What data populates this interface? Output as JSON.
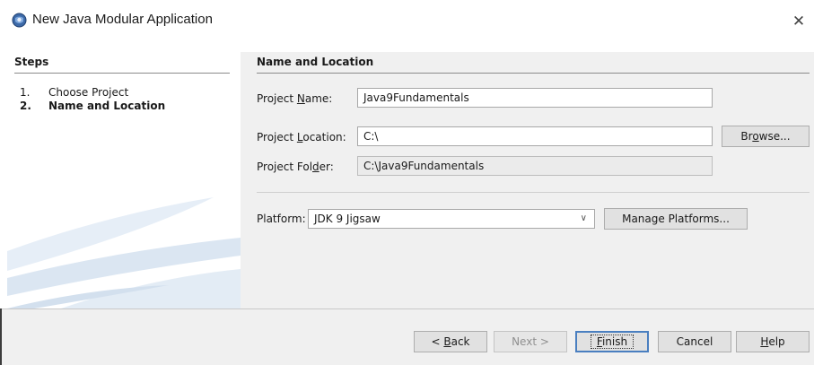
{
  "window": {
    "title": "New Java Modular Application",
    "close_glyph": "✕"
  },
  "steps": {
    "title": "Steps",
    "items": [
      {
        "num": "1.",
        "label": "Choose Project",
        "current": false
      },
      {
        "num": "2.",
        "label": "Name and Location",
        "current": true
      }
    ]
  },
  "section": {
    "title": "Name and Location"
  },
  "form": {
    "project_name": {
      "label_pre": "Project ",
      "label_key": "N",
      "label_post": "ame:",
      "value": "Java9Fundamentals"
    },
    "project_location": {
      "label_pre": "Project ",
      "label_key": "L",
      "label_post": "ocation:",
      "value": "C:\\"
    },
    "project_folder": {
      "label_pre": "Project Fol",
      "label_key": "d",
      "label_post": "er:",
      "value": "C:\\Java9Fundamentals"
    },
    "browse_pre": "Br",
    "browse_key": "o",
    "browse_post": "wse...",
    "platform_label": "Platform:",
    "platform_value": "JDK 9 Jigsaw",
    "manage_platforms": "Manage Platforms..."
  },
  "buttons": {
    "back_pre": "< ",
    "back_key": "B",
    "back_post": "ack",
    "next": "Next >",
    "finish_key": "F",
    "finish_post": "inish",
    "cancel": "Cancel",
    "help_key": "H",
    "help_post": "elp"
  },
  "colors": {
    "accent": "#4a7fc0",
    "panel": "#f0f0f0",
    "watermark": "#dde8f3"
  },
  "icons": {
    "app": "java-cup-icon",
    "dropdown": "chevron-down-icon",
    "close": "close-icon"
  }
}
